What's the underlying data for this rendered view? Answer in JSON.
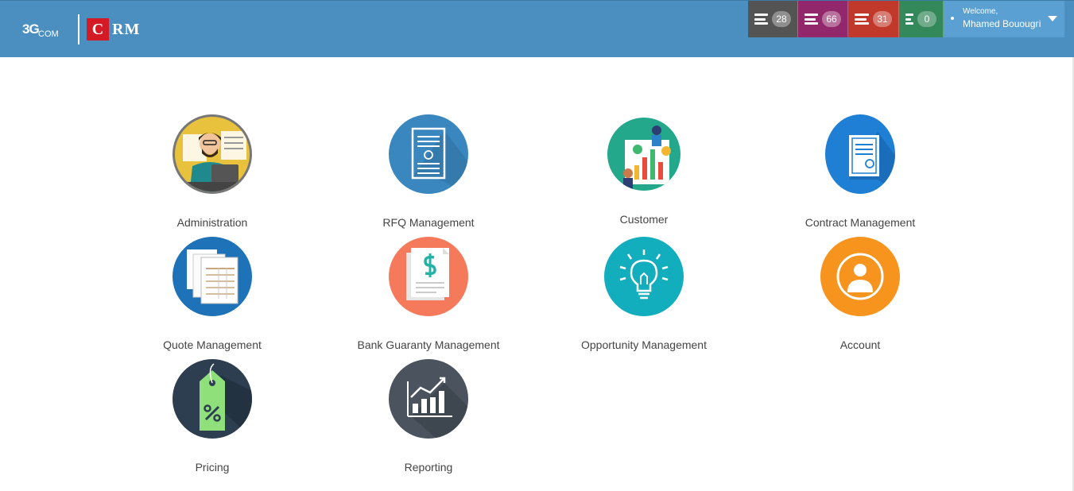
{
  "brand": {
    "logo_text": "3G",
    "logo_sub": "COM",
    "app_c": "C",
    "app_rm": "RM"
  },
  "counters": [
    {
      "count": "28",
      "color": "#545454"
    },
    {
      "count": "66",
      "color": "#93276b"
    },
    {
      "count": "31",
      "color": "#c0392b"
    },
    {
      "count": "0",
      "color": "#33895a"
    }
  ],
  "user": {
    "welcome": "Welcome,",
    "name": "Mhamed Bouougгi"
  },
  "modules": [
    {
      "label": "Administration",
      "icon": "administrator-icon",
      "color": "#e8c23c"
    },
    {
      "label": "RFQ Management",
      "icon": "invoice-document-icon",
      "color": "#3a86be"
    },
    {
      "label": "Customer",
      "icon": "customer-analytics-icon",
      "color": "#23a88c"
    },
    {
      "label": "Contract Management",
      "icon": "certificate-contract-icon",
      "color": "#1f7fd4"
    },
    {
      "label": "Quote Management",
      "icon": "quote-sheets-icon",
      "color": "#1d72b8"
    },
    {
      "label": "Bank Guaranty Management",
      "icon": "money-document-icon",
      "color": "#f47a5b"
    },
    {
      "label": "Opportunity Management",
      "icon": "lightbulb-icon",
      "color": "#13aebd"
    },
    {
      "label": "Account",
      "icon": "user-account-icon",
      "color": "#f7941d"
    },
    {
      "label": "Pricing",
      "icon": "price-tag-icon",
      "color": "#2c3e50"
    },
    {
      "label": "Reporting",
      "icon": "bar-chart-icon",
      "color": "#4a535e"
    }
  ]
}
